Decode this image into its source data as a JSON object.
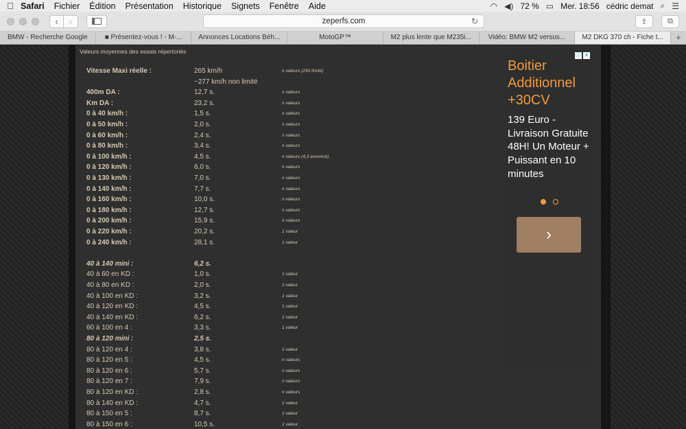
{
  "menubar": {
    "apple": "",
    "items": [
      "Safari",
      "Fichier",
      "Édition",
      "Présentation",
      "Historique",
      "Signets",
      "Fenêtre",
      "Aide"
    ],
    "battery": "72 %",
    "clock": "Mer. 18:56",
    "user": "cédric demat"
  },
  "toolbar": {
    "url": "zeperfs.com"
  },
  "tabs": [
    "BMW - Recherche Google",
    "■ Présentez-vous ! - M-...",
    "Annonces Locations Béh...",
    "MotoGP™",
    "M2 plus lente que M235i...",
    "Vidéo: BMW M2 versus...",
    "M2 DKG 370 ch - Fiche t..."
  ],
  "active_tab": 6,
  "section_title": "Valeurs moyennes des essais répertoriés",
  "rows": [
    {
      "label": "Vitesse Maxi réelle :",
      "value": "265 km/h",
      "note": "n valeurs (250 limité)",
      "style": "b"
    },
    {
      "label": "",
      "value": "~277 km/h non limité",
      "note": "",
      "style": "b"
    },
    {
      "label": "400m DA :",
      "value": "12,7 s.",
      "note": "n valeurs",
      "style": "b"
    },
    {
      "label": "Km DA :",
      "value": "23,2 s.",
      "note": "n valeurs",
      "style": "b"
    },
    {
      "label": "0 à 40 km/h :",
      "value": "1,5 s.",
      "note": "n valeurs",
      "style": "b"
    },
    {
      "label": "0 à 50 km/h :",
      "value": "2,0 s.",
      "note": "n valeurs",
      "style": "b"
    },
    {
      "label": "0 à 60 km/h :",
      "value": "2,4 s.",
      "note": "n valeurs",
      "style": "b"
    },
    {
      "label": "0 à 80 km/h :",
      "value": "3,4 s.",
      "note": "n valeurs",
      "style": "b"
    },
    {
      "label": "0 à 100 km/h :",
      "value": "4,5 s.",
      "note": "n valeurs (4,3 annoncé)",
      "style": "b"
    },
    {
      "label": "0 à 120 km/h :",
      "value": "6,0 s.",
      "note": "n valeurs",
      "style": "b"
    },
    {
      "label": "0 à 130 km/h :",
      "value": "7,0 s.",
      "note": "n valeurs",
      "style": "b"
    },
    {
      "label": "0 à 140 km/h :",
      "value": "7,7 s.",
      "note": "n valeurs",
      "style": "b"
    },
    {
      "label": "0 à 160 km/h :",
      "value": "10,0 s.",
      "note": "n valeurs",
      "style": "b"
    },
    {
      "label": "0 à 180 km/h :",
      "value": "12,7 s.",
      "note": "n valeurs",
      "style": "b"
    },
    {
      "label": "0 à 200 km/h :",
      "value": "15,9 s.",
      "note": "n valeurs",
      "style": "b"
    },
    {
      "label": "0 à 220 km/h :",
      "value": "20,2 s.",
      "note": "1 valeur",
      "style": "b"
    },
    {
      "label": "0 à 240 km/h :",
      "value": "28,1 s.",
      "note": "1 valeur",
      "style": "b"
    },
    {
      "label": "40 à 140 mini :",
      "value": "6,2 s.",
      "note": "",
      "style": "h"
    },
    {
      "label": "40 à 60 en KD :",
      "value": "1,0 s.",
      "note": "1 valeur",
      "style": ""
    },
    {
      "label": "40 à 80 en KD :",
      "value": "2,0 s.",
      "note": "1 valeur",
      "style": ""
    },
    {
      "label": "40 à 100 en KD :",
      "value": "3,2 s.",
      "note": "1 valeur",
      "style": ""
    },
    {
      "label": "40 à 120 en KD :",
      "value": "4,5 s.",
      "note": "1 valeur",
      "style": ""
    },
    {
      "label": "40 à 140 en KD :",
      "value": "6,2 s.",
      "note": "1 valeur",
      "style": ""
    },
    {
      "label": "60 à 100 en 4 :",
      "value": "3,3 s.",
      "note": "1 valeur",
      "style": ""
    },
    {
      "label": "80 à 120 mini :",
      "value": "2,5 s.",
      "note": "",
      "style": "h"
    },
    {
      "label": "80 à 120 en 4 :",
      "value": "3,8 s.",
      "note": "1 valeur",
      "style": ""
    },
    {
      "label": "80 à 120 en 5 :",
      "value": "4,5 s.",
      "note": "n valeurs",
      "style": ""
    },
    {
      "label": "80 à 120 en 6 :",
      "value": "5,7 s.",
      "note": "n valeurs",
      "style": ""
    },
    {
      "label": "80 à 120 en 7 :",
      "value": "7,9 s.",
      "note": "n valeurs",
      "style": ""
    },
    {
      "label": "80 à 120 en KD :",
      "value": "2,8 s.",
      "note": "n valeurs",
      "style": ""
    },
    {
      "label": "80 à 140 en KD :",
      "value": "4,7 s.",
      "note": "1 valeur",
      "style": ""
    },
    {
      "label": "80 à 150 en 5 :",
      "value": "8,7 s.",
      "note": "1 valeur",
      "style": ""
    },
    {
      "label": "80 à 150 en 6 :",
      "value": "10,5 s.",
      "note": "1 valeur",
      "style": ""
    }
  ],
  "ad": {
    "title": "Boitier Additionnel +30CV",
    "body": "139 Euro - Livraison Gratuite 48H! Un Moteur + Puissant en 10 minutes",
    "button": "›",
    "colors": {
      "title": "#f39a3d",
      "button": "#a17f63"
    }
  }
}
